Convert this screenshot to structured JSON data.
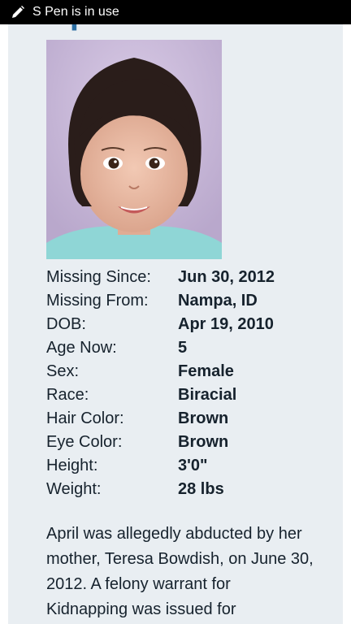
{
  "status_bar": {
    "text": "S Pen is in use",
    "icon": "pen-icon"
  },
  "profile": {
    "name": "April Bowdish",
    "photo_icon": "child-portrait-photo",
    "details": [
      {
        "label": "Missing Since:",
        "value": "Jun 30, 2012"
      },
      {
        "label": "Missing From:",
        "value": "Nampa, ID"
      },
      {
        "label": "DOB:",
        "value": "Apr 19, 2010"
      },
      {
        "label": "Age Now:",
        "value": "5"
      },
      {
        "label": "Sex:",
        "value": "Female"
      },
      {
        "label": "Race:",
        "value": "Biracial"
      },
      {
        "label": "Hair Color:",
        "value": "Brown"
      },
      {
        "label": "Eye Color:",
        "value": "Brown"
      },
      {
        "label": "Height:",
        "value": "3'0\""
      },
      {
        "label": "Weight:",
        "value": "28 lbs"
      }
    ],
    "description": "April was allegedly abducted by her mother, Teresa Bowdish, on June 30, 2012. A felony warrant for Kidnapping was issued for"
  },
  "colors": {
    "card_background": "#e9eef2",
    "title": "#2b6ea3",
    "text": "#16222d",
    "status_bar": "#000000"
  }
}
